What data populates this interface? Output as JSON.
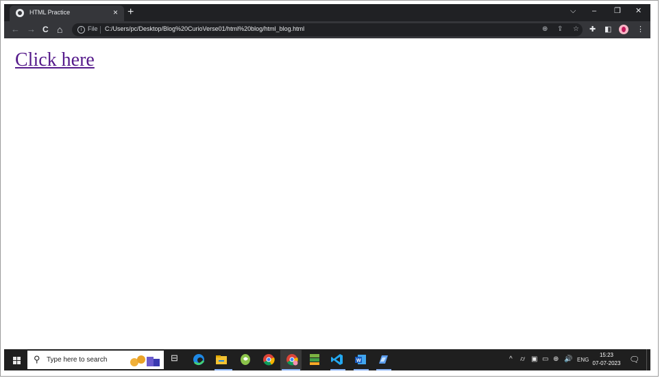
{
  "tab": {
    "title": "HTML Practice",
    "close": "×"
  },
  "tabstrip": {
    "new_tab": "+",
    "chevron": "⌵",
    "minimize": "–",
    "restore": "❐",
    "close": "✕"
  },
  "nav": {
    "back": "←",
    "forward": "→",
    "reload": "C",
    "home": "⌂"
  },
  "omnibox": {
    "info": "i",
    "scheme_label": "File",
    "url": "C:/Users/pc/Desktop/Blog%20CurioVerse01/html%20blog/html_blog.html",
    "zoom": "⊕",
    "share": "⇪",
    "star": "☆"
  },
  "toolbar": {
    "extensions": "✚",
    "sidepanel": "◧",
    "menu": "⋮"
  },
  "page": {
    "link_text": "Click here"
  },
  "taskbar": {
    "search_placeholder": "Type here to search",
    "search_glyph": "⚲",
    "task_view": "⊟",
    "tray_chevron": "^",
    "tray_lang": "ENG",
    "volume": "🔊",
    "time": "15:23",
    "date": "07-07-2023",
    "notifications": "🗨"
  },
  "colors": {
    "link": "#551a8b",
    "tabstrip": "#202124",
    "toolbar": "#35363a",
    "taskbar": "#1f1f1f"
  }
}
